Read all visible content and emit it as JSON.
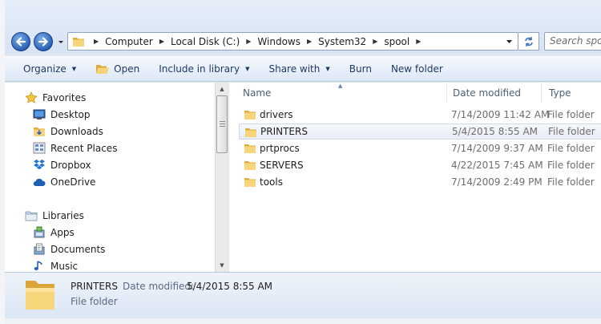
{
  "address": {
    "crumbs": [
      "Computer",
      "Local Disk (C:)",
      "Windows",
      "System32",
      "spool"
    ],
    "search_placeholder": "Search spool"
  },
  "toolbar": {
    "organize": "Organize",
    "open": "Open",
    "include_in_library": "Include in library",
    "share_with": "Share with",
    "burn": "Burn",
    "new_folder": "New folder"
  },
  "nav": {
    "favorites": "Favorites",
    "desktop": "Desktop",
    "downloads": "Downloads",
    "recent_places": "Recent Places",
    "dropbox": "Dropbox",
    "onedrive": "OneDrive",
    "libraries": "Libraries",
    "apps": "Apps",
    "documents": "Documents",
    "music": "Music"
  },
  "columns": {
    "name": "Name",
    "date_modified": "Date modified",
    "type": "Type"
  },
  "files": [
    {
      "name": "drivers",
      "date": "7/14/2009 11:42 AM",
      "type": "File folder"
    },
    {
      "name": "PRINTERS",
      "date": "5/4/2015 8:55 AM",
      "type": "File folder"
    },
    {
      "name": "prtprocs",
      "date": "7/14/2009 9:37 AM",
      "type": "File folder"
    },
    {
      "name": "SERVERS",
      "date": "4/22/2015 7:45 AM",
      "type": "File folder"
    },
    {
      "name": "tools",
      "date": "7/14/2009 2:49 PM",
      "type": "File folder"
    }
  ],
  "selected_index": 1,
  "details": {
    "name": "PRINTERS",
    "date_label": "Date modified:",
    "date_value": "5/4/2015 8:55 AM",
    "type": "File folder"
  },
  "colors": {
    "accent": "#2b62b5",
    "folder": "#f3c95c"
  }
}
